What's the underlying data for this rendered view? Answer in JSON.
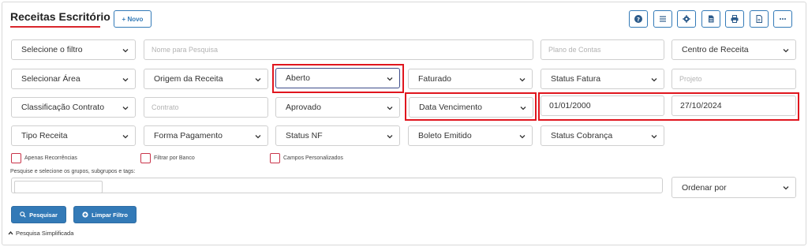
{
  "header": {
    "title": "Receitas Escritório",
    "novo_label": "+ Novo"
  },
  "toolbar": {
    "icons": [
      "help-icon",
      "menu-list-icon",
      "gear-icon",
      "document-icon",
      "print-icon",
      "file-icon",
      "more-icon"
    ]
  },
  "filters": {
    "filtro": "Selecione o filtro",
    "nome_placeholder": "Nome para Pesquisa",
    "plano_placeholder": "Plano de Contas",
    "centro": "Centro de Receita",
    "area": "Selecionar Área",
    "origem": "Origem da Receita",
    "status_aberto": "Aberto",
    "faturado": "Faturado",
    "status_fatura": "Status Fatura",
    "projeto_placeholder": "Projeto",
    "classificacao": "Classificação Contrato",
    "contrato_placeholder": "Contrato",
    "aprovado": "Aprovado",
    "data_vencimento": "Data Vencimento",
    "data_inicio": "01/01/2000",
    "data_fim": "27/10/2024",
    "tipo_receita": "Tipo Receita",
    "forma_pagamento": "Forma Pagamento",
    "status_nf": "Status NF",
    "boleto_emitido": "Boleto Emitido",
    "status_cobranca": "Status Cobrança"
  },
  "checkboxes": {
    "recorrencias": "Apenas Recorrências",
    "banco": "Filtrar por Banco",
    "personalizados": "Campos Personalizados"
  },
  "tags": {
    "label": "Pesquise e selecione os grupos, subgrupos e tags:"
  },
  "ordenar": "Ordenar por",
  "actions": {
    "pesquisar": "Pesquisar",
    "limpar": "Limpar Filtro"
  },
  "footer": {
    "pesquisa_simplificada": "Pesquisa Simplificada"
  },
  "colors": {
    "primary": "#337ab7",
    "highlight": "#e0161e",
    "accent_underline": "#d9262c"
  }
}
